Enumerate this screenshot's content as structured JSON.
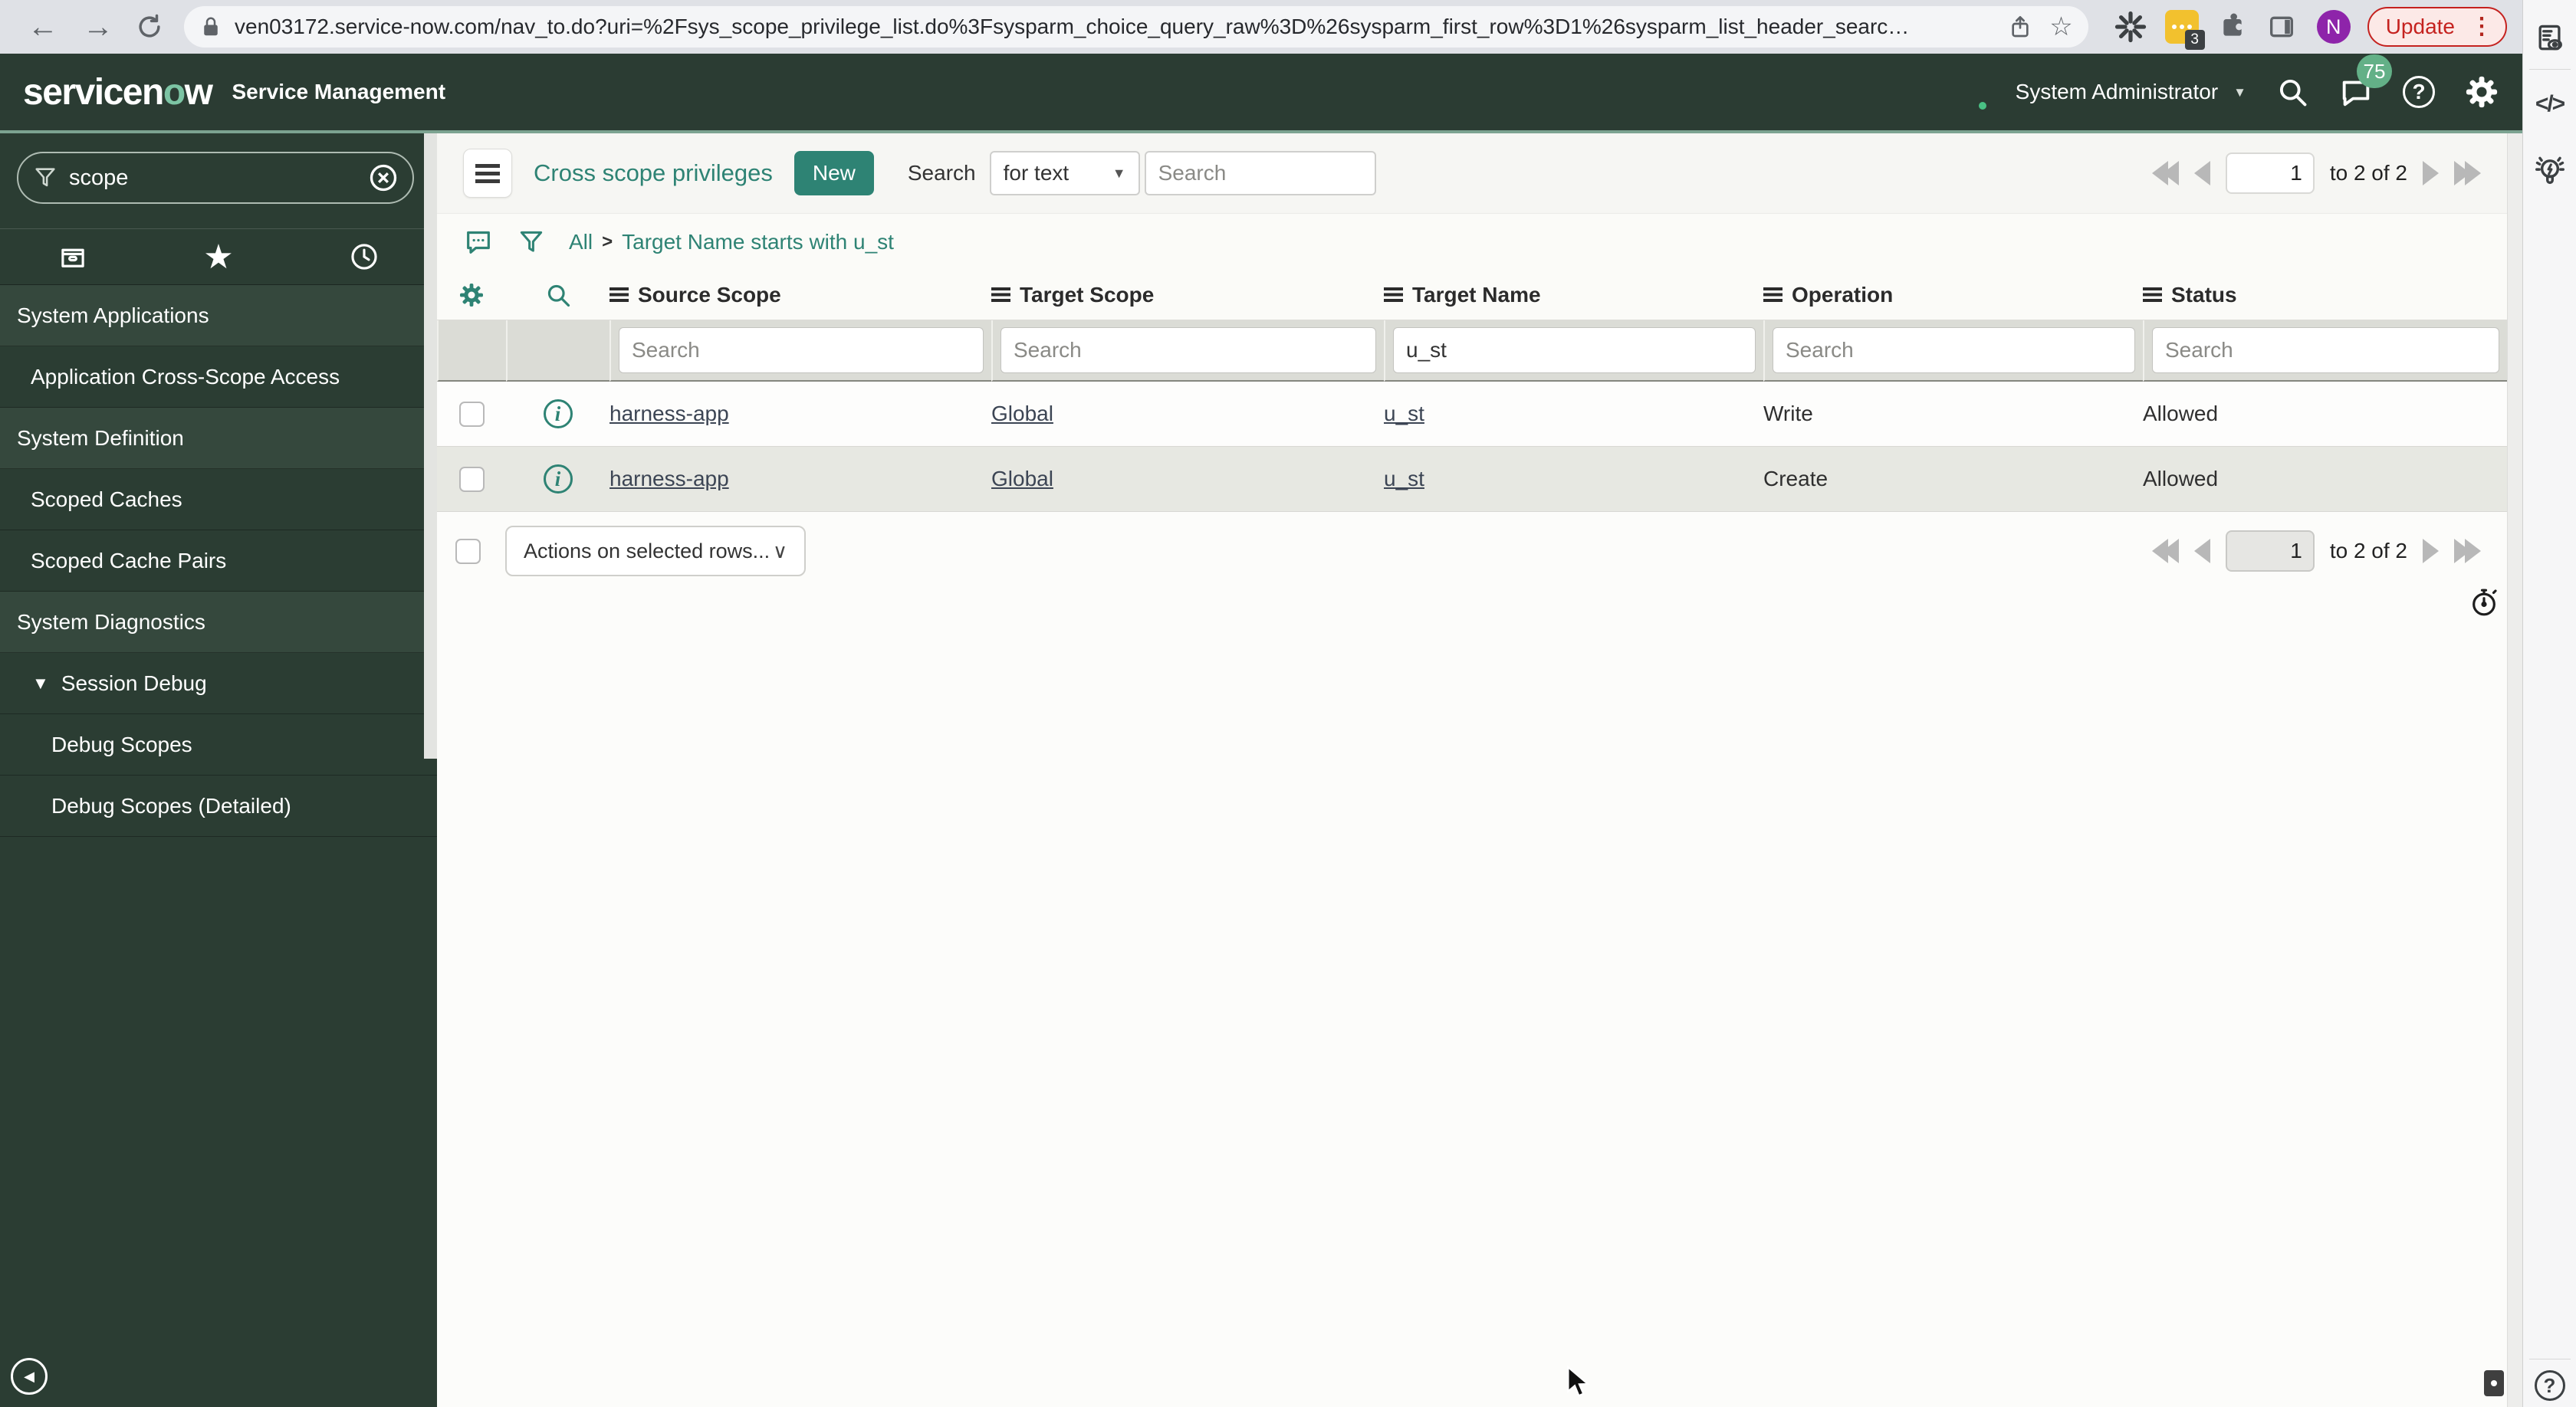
{
  "icons": {
    "back": "←",
    "forward": "→",
    "star": "☆",
    "kebab": "⋮",
    "caret_down": "▼",
    "chevron_down": "∨",
    "code": "</>",
    "question": "?",
    "info": "i",
    "collapse": "◀",
    "logo_o": "o"
  },
  "browser": {
    "url": "ven03172.service-now.com/nav_to.do?uri=%2Fsys_scope_privilege_list.do%3Fsysparm_choice_query_raw%3D%26sysparm_first_row%3D1%26sysparm_list_header_searc…",
    "update_label": "Update",
    "profile_initial": "N",
    "extension_badge": "3"
  },
  "banner": {
    "logo_prefix": "servicen",
    "logo_suffix": "w",
    "product": "Service Management",
    "user": "System Administrator",
    "chat_badge": "75"
  },
  "sidebar": {
    "search_value": "scope",
    "items": [
      {
        "label": "System Applications",
        "type": "header"
      },
      {
        "label": "Application Cross-Scope Access",
        "type": "child"
      },
      {
        "label": "System Definition",
        "type": "header"
      },
      {
        "label": "Scoped Caches",
        "type": "child"
      },
      {
        "label": "Scoped Cache Pairs",
        "type": "child"
      },
      {
        "label": "System Diagnostics",
        "type": "header"
      },
      {
        "label": "Session Debug",
        "type": "expanded-group"
      },
      {
        "label": "Debug Scopes",
        "type": "subchild"
      },
      {
        "label": "Debug Scopes (Detailed)",
        "type": "subchild"
      }
    ]
  },
  "list": {
    "title": "Cross scope privileges",
    "new_button": "New",
    "search_label": "Search",
    "search_type": "for text",
    "search_placeholder": "Search",
    "breadcrumb": {
      "root": "All",
      "separator": ">",
      "current": "Target Name starts with u_st"
    },
    "columns": [
      "Source Scope",
      "Target Scope",
      "Target Name",
      "Operation",
      "Status"
    ],
    "filters": {
      "source_scope": "",
      "target_scope": "",
      "target_name": "u_st",
      "operation": "",
      "status": ""
    },
    "rows": [
      {
        "source_scope": "harness-app",
        "target_scope": "Global",
        "target_name": "u_st",
        "operation": "Write",
        "status": "Allowed"
      },
      {
        "source_scope": "harness-app",
        "target_scope": "Global",
        "target_name": "u_st",
        "operation": "Create",
        "status": "Allowed"
      }
    ],
    "actions_label": "Actions on selected rows...",
    "pagination": {
      "page": "1",
      "range": "to 2 of 2"
    }
  },
  "colors": {
    "accent_teal": "#2e8374",
    "banner_bg": "#2b3c33",
    "update_red": "#c5221f",
    "badge_green": "#63b087"
  }
}
